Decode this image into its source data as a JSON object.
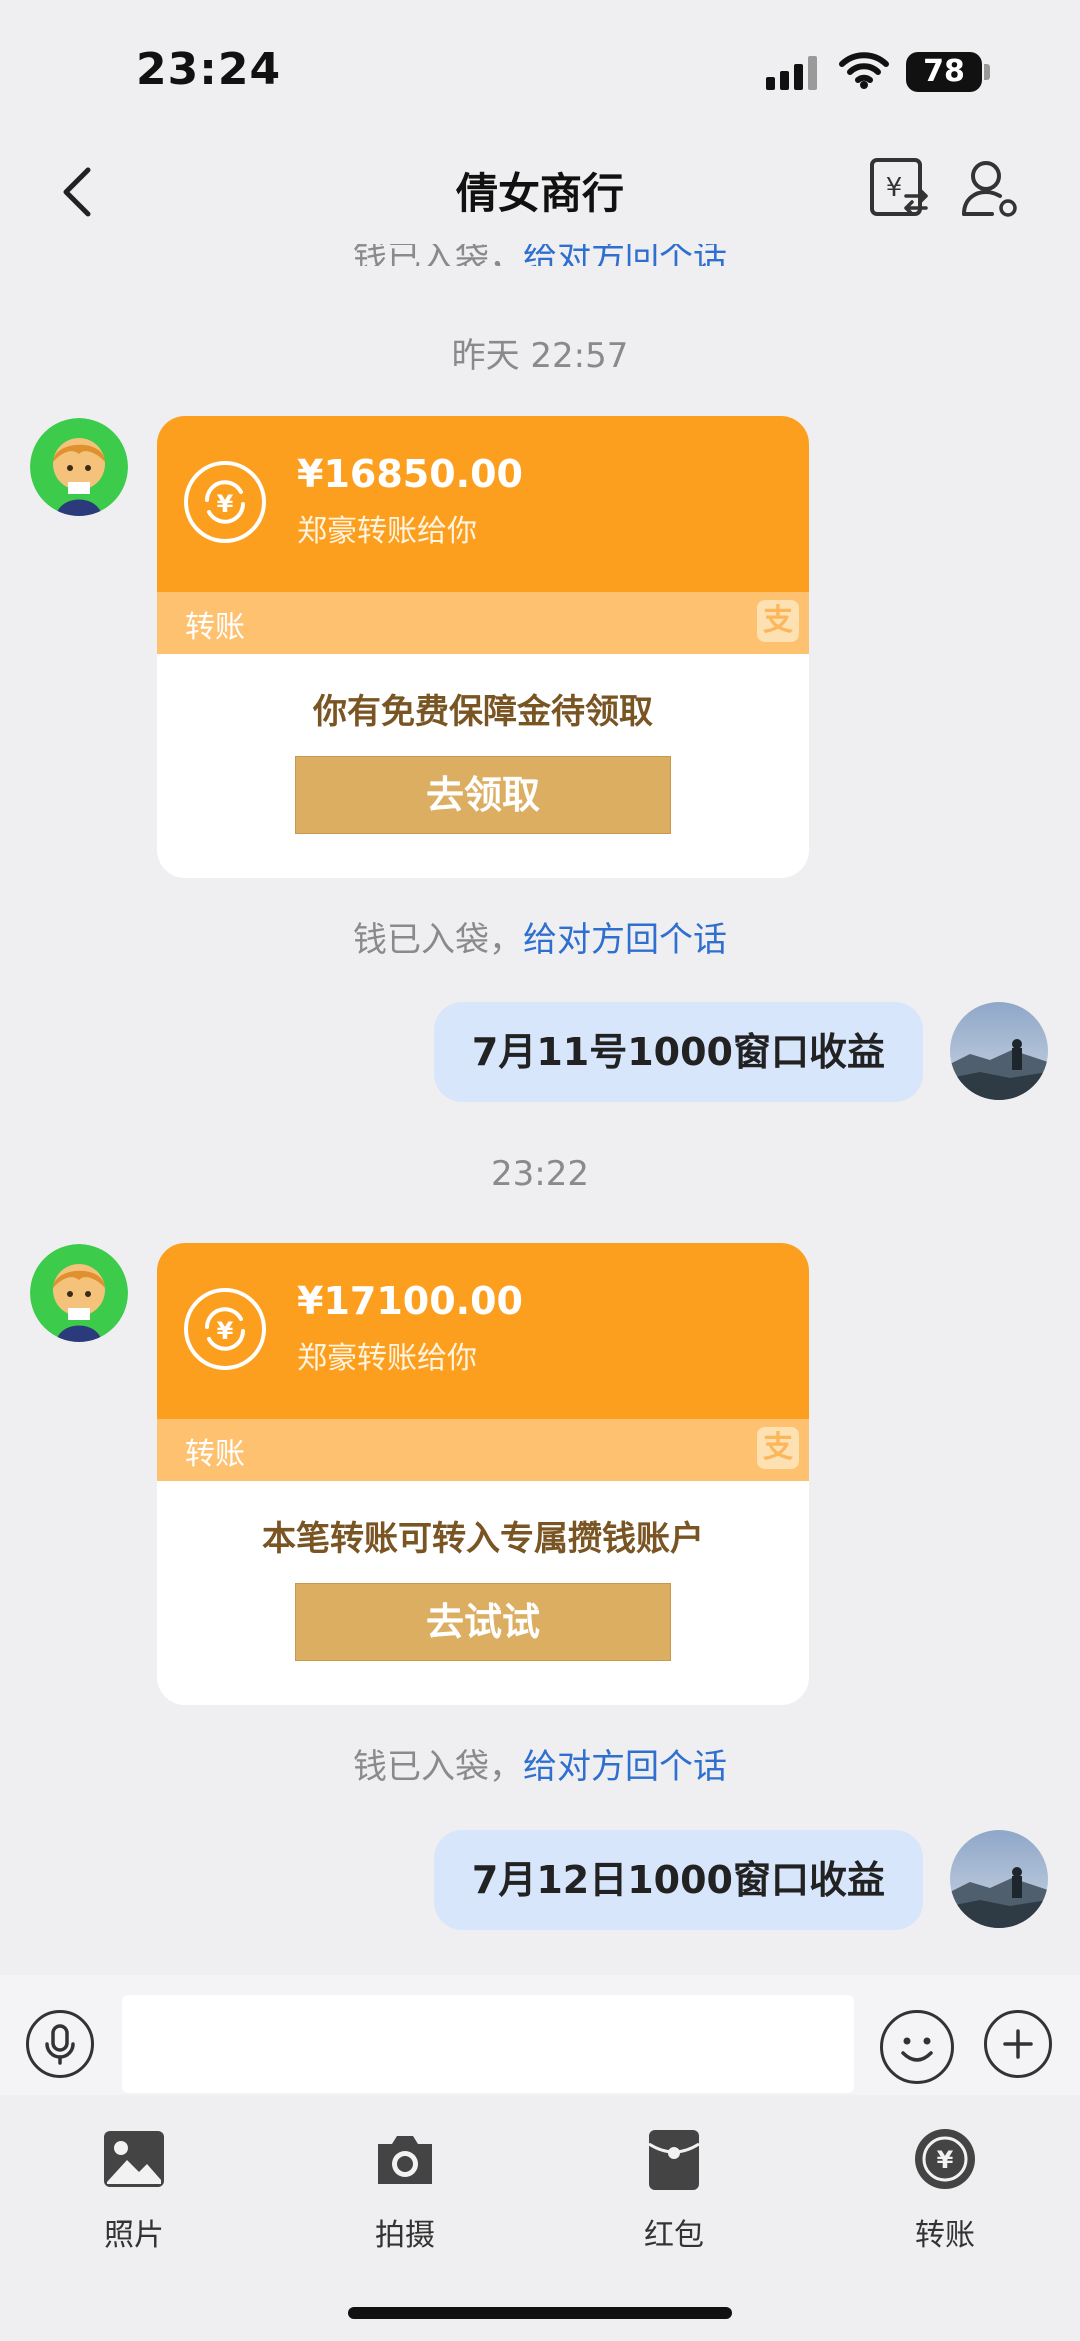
{
  "status_bar": {
    "time": "23:24",
    "battery": "78"
  },
  "header": {
    "title": "倩女商行"
  },
  "partial_top_line": {
    "text": "钱已入袋，",
    "link": "给对方回个话"
  },
  "messages": [
    {
      "timestamp": "昨天 22:57"
    },
    {
      "card": {
        "amount": "¥16850.00",
        "from": "郑豪转账给你",
        "band_label": "转账",
        "message": "你有免费保障金待领取",
        "button": "去领取"
      }
    },
    {
      "system": "钱已入袋，",
      "link": "给对方回个话"
    },
    {
      "mine": "7月11号1000窗口收益"
    },
    {
      "timestamp": "23:22"
    },
    {
      "card": {
        "amount": "¥17100.00",
        "from": "郑豪转账给你",
        "band_label": "转账",
        "message": "本笔转账可转入专属攒钱账户",
        "button": "去试试"
      }
    },
    {
      "system": "钱已入袋，",
      "link": "给对方回个话"
    },
    {
      "mine": "7月12日1000窗口收益"
    }
  ],
  "toolbar": [
    {
      "label": "照片",
      "icon": "photo-icon"
    },
    {
      "label": "拍摄",
      "icon": "camera-icon"
    },
    {
      "label": "红包",
      "icon": "red-packet-icon"
    },
    {
      "label": "转账",
      "icon": "transfer-icon"
    }
  ],
  "colors": {
    "orange": "#fd9f1e",
    "band": "#fec170",
    "button_gold": "#dcae62",
    "my_bubble": "#d8e6fc",
    "link": "#2f6fd0"
  }
}
